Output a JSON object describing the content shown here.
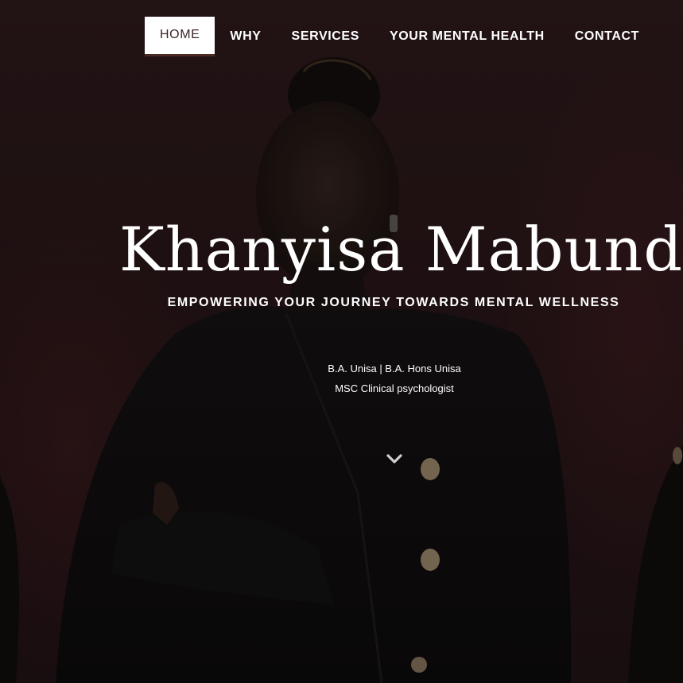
{
  "nav": {
    "items": [
      {
        "label": "HOME",
        "active": true
      },
      {
        "label": "WHY",
        "active": false
      },
      {
        "label": "SERVICES",
        "active": false
      },
      {
        "label": "YOUR MENTAL HEALTH",
        "active": false
      },
      {
        "label": "CONTACT",
        "active": false
      }
    ]
  },
  "hero": {
    "title": "Khanyisa Mabunda",
    "subtitle": "EMPOWERING YOUR JOURNEY TOWARDS MENTAL WELLNESS",
    "credentials_line1": "B.A. Unisa | B.A. Hons Unisa",
    "credentials_line2": "MSC Clinical psychologist",
    "scroll_icon": "chevron-down-icon",
    "background_image": "portrait-photo"
  },
  "colors": {
    "background": "#1e1113",
    "nav_active_bg": "#ffffff",
    "nav_active_text": "#3a2626",
    "text": "#ffffff"
  }
}
